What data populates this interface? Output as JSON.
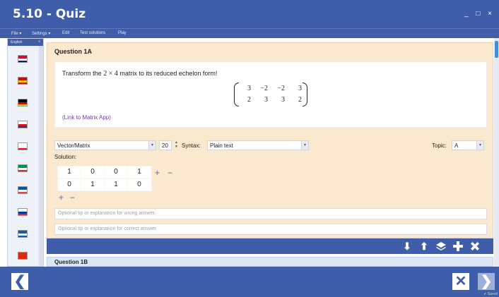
{
  "window": {
    "title": "5.10 - Quiz",
    "controls": [
      "_",
      "□",
      "×"
    ]
  },
  "menu": {
    "file": "File",
    "settings": "Settings",
    "edit": "Edit",
    "test_solutions": "Test solutions",
    "play": "Play"
  },
  "language_panel": {
    "title": "English",
    "collapse": "«",
    "flags": [
      {
        "name": "uk-flag",
        "colors": [
          "#c8102e",
          "#ffffff",
          "#012169"
        ]
      },
      {
        "name": "spain-flag",
        "colors": [
          "#c60b1e",
          "#ffc400",
          "#c60b1e"
        ]
      },
      {
        "name": "germany-flag",
        "colors": [
          "#000000",
          "#dd0000",
          "#ffce00"
        ]
      },
      {
        "name": "czech-flag",
        "colors": [
          "#ffffff",
          "#d7141a",
          "#11457e"
        ]
      },
      {
        "name": "poland-flag",
        "colors": [
          "#ffffff",
          "#ffffff",
          "#dc143c"
        ]
      },
      {
        "name": "italy-flag",
        "colors": [
          "#009246",
          "#ffffff",
          "#ce2b37"
        ]
      },
      {
        "name": "france-flag",
        "colors": [
          "#0055a4",
          "#ffffff",
          "#ef4135"
        ]
      },
      {
        "name": "russia-flag",
        "colors": [
          "#ffffff",
          "#0039a6",
          "#d52b1e"
        ]
      },
      {
        "name": "greece-flag",
        "colors": [
          "#0d5eaf",
          "#ffffff",
          "#0d5eaf"
        ]
      },
      {
        "name": "china-flag",
        "colors": [
          "#de2910",
          "#de2910",
          "#de2910"
        ]
      }
    ]
  },
  "question": {
    "title": "Question 1A",
    "text_before": "Transform the",
    "dims": "2 × 4",
    "text_after": "matrix to its reduced echelon form!",
    "matrix": [
      [
        "3",
        "−2",
        "−2",
        "3"
      ],
      [
        "2",
        "3",
        "3",
        "2"
      ]
    ],
    "link": "(Link to Matrix App)"
  },
  "answer": {
    "type_value": "Vector/Matrix",
    "size_value": "20",
    "syntax_label": "Syntax:",
    "syntax_value": "Plain text",
    "topic_label": "Topic:",
    "topic_value": "A",
    "solution_label": "Solution:",
    "solution": [
      [
        "1",
        "0",
        "0",
        "1"
      ],
      [
        "0",
        "1",
        "1",
        "0"
      ]
    ],
    "plus": "+",
    "minus": "−",
    "wrong_placeholder": "Optional tip or explanation for wrong answer.",
    "correct_placeholder": "Optional tip or explanation for correct answer."
  },
  "toolbar_icons": [
    "arrow-down-icon",
    "arrow-up-icon",
    "layers-icon",
    "plus-icon",
    "close-icon"
  ],
  "next_question": {
    "title": "Question 1B"
  },
  "bottom": {
    "back": "❮",
    "close": "✕",
    "next": "❯",
    "saved": "✔ Saved"
  },
  "colors": {
    "primary": "#3f5da8",
    "card": "#fbe9cf",
    "link": "#6b3fa8",
    "accent": "#3b8fd8"
  }
}
